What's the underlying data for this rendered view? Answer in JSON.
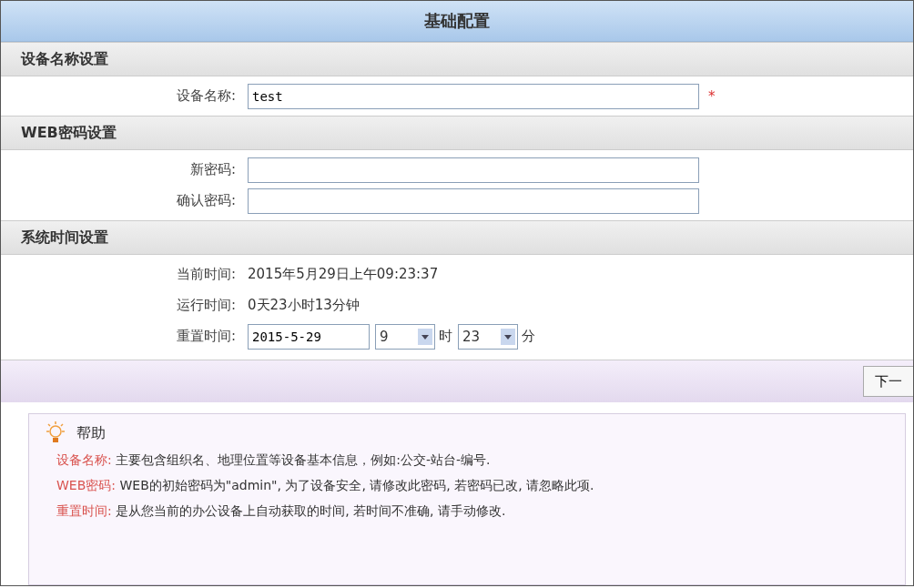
{
  "title": "基础配置",
  "sections": [
    {
      "heading": "设备名称设置",
      "rows": [
        {
          "kind": "input",
          "label": "设备名称:",
          "value": "test",
          "required_mark": "*"
        }
      ]
    },
    {
      "heading": "WEB密码设置",
      "rows": [
        {
          "kind": "input",
          "label": "新密码:",
          "value": ""
        },
        {
          "kind": "input",
          "label": "确认密码:",
          "value": ""
        }
      ]
    },
    {
      "heading": "系统时间设置",
      "rows": [
        {
          "kind": "text",
          "label": "当前时间:",
          "value": "2015年5月29日上午09:23:37"
        },
        {
          "kind": "text",
          "label": "运行时间:",
          "value": "0天23小时13分钟"
        },
        {
          "kind": "datetime",
          "label": "重置时间:",
          "date": "2015-5-29",
          "hour": "9",
          "hour_unit": "时",
          "minute": "23",
          "minute_unit": "分"
        }
      ]
    }
  ],
  "next_button": "下一",
  "help": {
    "title": "帮助",
    "items": [
      {
        "term": "设备名称:",
        "text": "主要包含组织名、地理位置等设备基本信息，例如:公交-站台-编号."
      },
      {
        "term": "WEB密码:",
        "text": "WEB的初始密码为\"admin\", 为了设备安全, 请修改此密码, 若密码已改, 请忽略此项."
      },
      {
        "term": "重置时间:",
        "text": "是从您当前的办公设备上自动获取的时间, 若时间不准确, 请手动修改."
      }
    ]
  }
}
